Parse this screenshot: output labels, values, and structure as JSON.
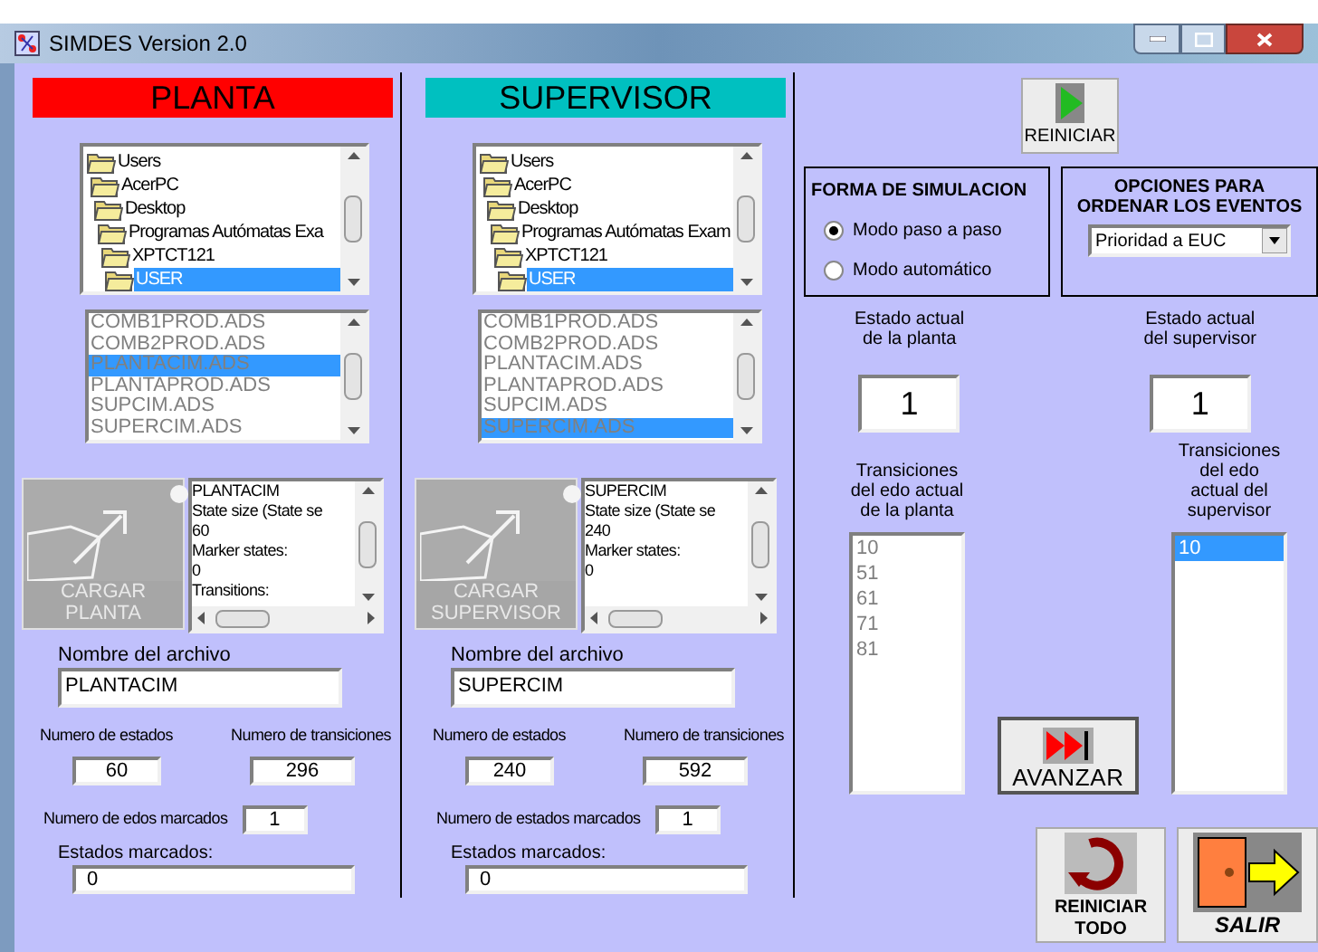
{
  "window": {
    "title": "SIMDES Version 2.0"
  },
  "panels": [
    {
      "title": "PLANTA",
      "color": "#ff0000",
      "tree": [
        {
          "label": "Users",
          "selected": false,
          "children": [
            {
              "label": "AcerPC",
              "selected": false,
              "children": [
                {
                  "label": "Desktop",
                  "selected": false,
                  "children": [
                    {
                      "label": "Programas Autómatas Exa",
                      "selected": false,
                      "children": [
                        {
                          "label": "XPTCT121",
                          "selected": false,
                          "children": [
                            {
                              "label": "USER",
                              "selected": true
                            }
                          ]
                        }
                      ]
                    }
                  ]
                }
              ]
            }
          ]
        }
      ],
      "files": [
        {
          "label": "COMB1PROD.ADS",
          "selected": false
        },
        {
          "label": "COMB2PROD.ADS",
          "selected": false
        },
        {
          "label": "PLANTACIM.ADS",
          "selected": true
        },
        {
          "label": "PLANTAPROD.ADS",
          "selected": false
        },
        {
          "label": "SUPCIM.ADS",
          "selected": false
        },
        {
          "label": "SUPERCIM.ADS",
          "selected": false
        }
      ],
      "load_button": "CARGAR PLANTA",
      "info_lines": [
        "PLANTACIM",
        "State size (State se",
        "60",
        "Marker states:",
        "0",
        "Transitions:"
      ],
      "filename_label": "Nombre del archivo",
      "filename": "PLANTACIM",
      "states_label": "Numero de estados",
      "states": "60",
      "transitions_label": "Numero de transiciones",
      "transitions": "296",
      "marked_count_label": "Numero de edos marcados",
      "marked_count": "1",
      "marked_label": "Estados marcados:",
      "marked": "0"
    },
    {
      "title": "SUPERVISOR",
      "color": "#00c0c0",
      "tree": [
        {
          "label": "Users",
          "selected": false,
          "children": [
            {
              "label": "AcerPC",
              "selected": false,
              "children": [
                {
                  "label": "Desktop",
                  "selected": false,
                  "children": [
                    {
                      "label": "Programas Autómatas Exam",
                      "selected": false,
                      "children": [
                        {
                          "label": "XPTCT121",
                          "selected": false,
                          "children": [
                            {
                              "label": "USER",
                              "selected": true
                            }
                          ]
                        }
                      ]
                    }
                  ]
                }
              ]
            }
          ]
        }
      ],
      "files": [
        {
          "label": "COMB1PROD.ADS",
          "selected": false
        },
        {
          "label": "COMB2PROD.ADS",
          "selected": false
        },
        {
          "label": "PLANTACIM.ADS",
          "selected": false
        },
        {
          "label": "PLANTAPROD.ADS",
          "selected": false
        },
        {
          "label": "SUPCIM.ADS",
          "selected": false
        },
        {
          "label": "SUPERCIM.ADS",
          "selected": true
        }
      ],
      "load_button": "CARGAR\nSUPERVISOR",
      "info_lines": [
        "SUPERCIM",
        "State size (State se",
        "240",
        "Marker states:",
        "0"
      ],
      "filename_label": "Nombre del archivo",
      "filename": "SUPERCIM",
      "states_label": "Numero de estados",
      "states": "240",
      "transitions_label": "Numero de transiciones",
      "transitions": "592",
      "marked_count_label": "Numero de estados marcados",
      "marked_count": "1",
      "marked_label": "Estados marcados:",
      "marked": "0"
    }
  ],
  "restart_button": "REINICIAR",
  "simulation": {
    "title": "FORMA DE SIMULACION",
    "options": [
      {
        "label": "Modo paso a paso",
        "selected": true
      },
      {
        "label": "Modo automático",
        "selected": false
      }
    ]
  },
  "ordering": {
    "title": "OPCIONES PARA\nORDENAR LOS EVENTOS",
    "value": "Prioridad a EUC"
  },
  "plant_state": {
    "label": "Estado actual\nde la planta",
    "value": "1"
  },
  "supervisor_state": {
    "label": "Estado actual\ndel supervisor",
    "value": "1"
  },
  "plant_transitions": {
    "label": "Transiciones\ndel edo actual\nde la planta",
    "items": [
      {
        "label": "10",
        "selected": false
      },
      {
        "label": "51",
        "selected": false
      },
      {
        "label": "61",
        "selected": false
      },
      {
        "label": "71",
        "selected": false
      },
      {
        "label": "81",
        "selected": false
      }
    ]
  },
  "supervisor_transitions": {
    "label": "Transiciones\ndel edo\nactual del\nsupervisor",
    "items": [
      {
        "label": "10",
        "selected": true
      }
    ]
  },
  "advance_button": "AVANZAR",
  "reset_all_button": "REINICIAR\nTODO",
  "exit_button": "SALIR"
}
